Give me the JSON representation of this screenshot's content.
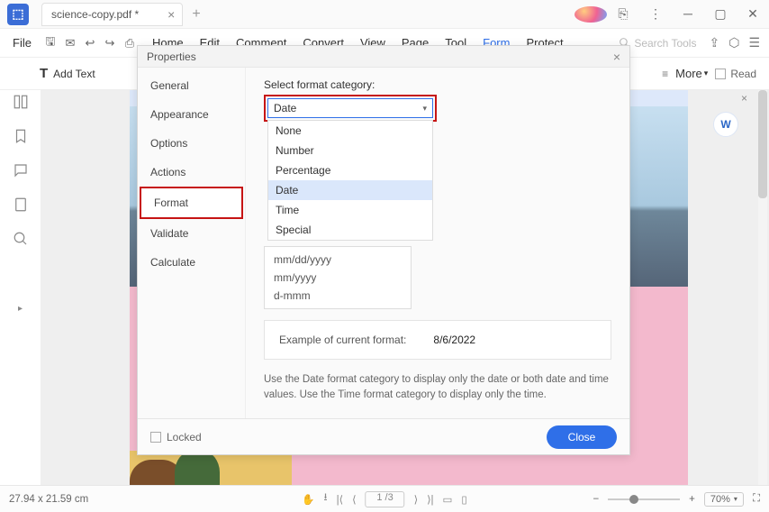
{
  "titlebar": {
    "tab_title": "science-copy.pdf *"
  },
  "menubar": {
    "file": "File",
    "tabs": {
      "home": "Home",
      "edit": "Edit",
      "comment": "Comment",
      "convert": "Convert",
      "view": "View",
      "page": "Page",
      "tool": "Tool",
      "form": "Form",
      "protect": "Protect"
    },
    "search_placeholder": "Search Tools"
  },
  "toolbar": {
    "add_text": "Add Text",
    "more": "More",
    "read": "Read"
  },
  "dialog": {
    "title": "Properties",
    "side": {
      "general": "General",
      "appearance": "Appearance",
      "options": "Options",
      "actions": "Actions",
      "format": "Format",
      "validate": "Validate",
      "calculate": "Calculate"
    },
    "select_label": "Select format category:",
    "selected_value": "Date",
    "options_list": {
      "none": "None",
      "number": "Number",
      "percentage": "Percentage",
      "date": "Date",
      "time": "Time",
      "special": "Special"
    },
    "date_formats": {
      "f1": "mm/dd/yyyy",
      "f2": "mm/yyyy",
      "f3": "d-mmm"
    },
    "example_label": "Example of current format:",
    "example_value": "8/6/2022",
    "help_text": "Use the Date format category to display only the date or both date and time values. Use the Time format category to display only the time.",
    "locked": "Locked",
    "close": "Close"
  },
  "statusbar": {
    "dims": "27.94 x 21.59 cm",
    "page": "1 /3",
    "zoom": "70%"
  }
}
